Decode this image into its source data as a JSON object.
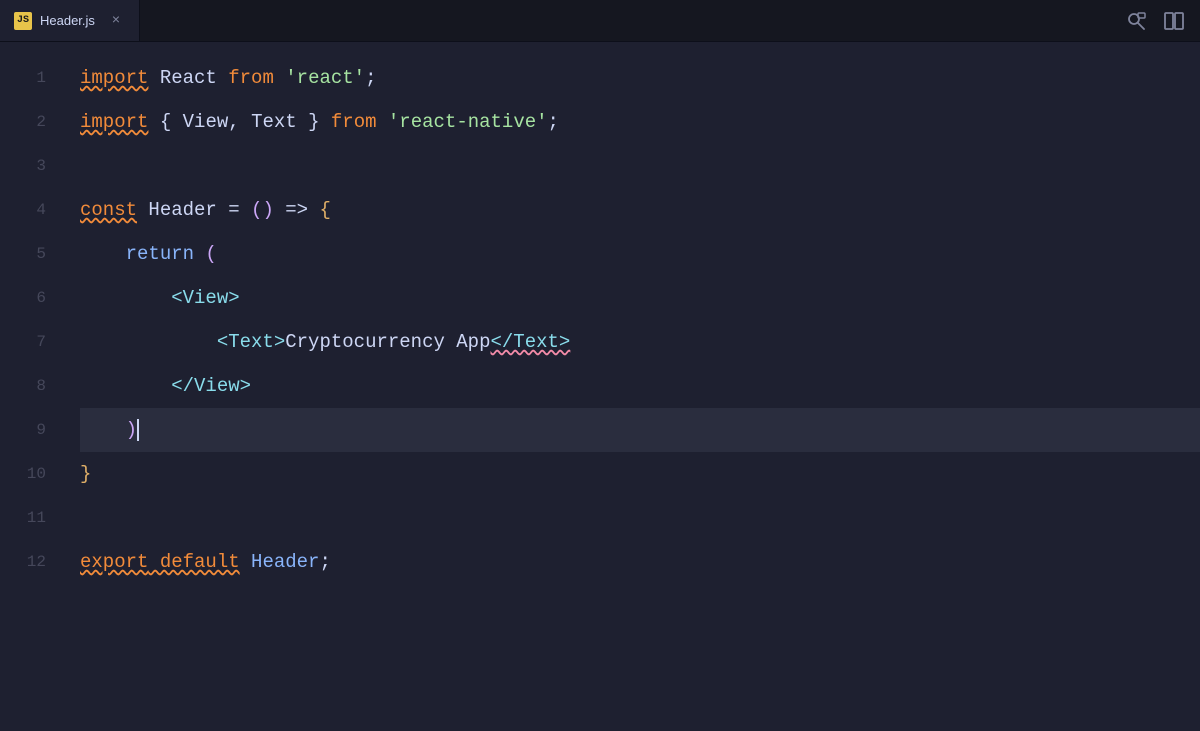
{
  "tab": {
    "icon_label": "JS",
    "filename": "Header.js",
    "close_label": "×"
  },
  "toolbar": {
    "search_icon": "🔍",
    "split_icon": "⊞"
  },
  "lines": [
    {
      "number": 1,
      "tokens": [
        {
          "t": "kw-import",
          "v": "import"
        },
        {
          "t": "identifier",
          "v": " React "
        },
        {
          "t": "kw-from",
          "v": "from"
        },
        {
          "t": "str",
          "v": " 'react'"
        },
        {
          "t": "punct",
          "v": ";"
        }
      ]
    },
    {
      "number": 2,
      "tokens": [
        {
          "t": "kw-import",
          "v": "import"
        },
        {
          "t": "punct",
          "v": " { "
        },
        {
          "t": "identifier",
          "v": "View"
        },
        {
          "t": "punct",
          "v": ", "
        },
        {
          "t": "identifier",
          "v": "Text"
        },
        {
          "t": "punct",
          "v": " } "
        },
        {
          "t": "kw-from",
          "v": "from"
        },
        {
          "t": "str",
          "v": " 'react-native'"
        },
        {
          "t": "punct",
          "v": ";"
        }
      ]
    },
    {
      "number": 3,
      "tokens": []
    },
    {
      "number": 4,
      "tokens": [
        {
          "t": "kw-const",
          "v": "const"
        },
        {
          "t": "identifier",
          "v": " Header "
        },
        {
          "t": "punct",
          "v": "= "
        },
        {
          "t": "paren",
          "v": "()"
        },
        {
          "t": "arrow",
          "v": " => "
        },
        {
          "t": "bracket",
          "v": "{"
        }
      ]
    },
    {
      "number": 5,
      "tokens": [
        {
          "t": "kw-return",
          "v": "return"
        },
        {
          "t": "paren",
          "v": " ("
        }
      ]
    },
    {
      "number": 6,
      "tokens": [
        {
          "t": "tag",
          "v": "<View>"
        }
      ]
    },
    {
      "number": 7,
      "tokens": [
        {
          "t": "tag",
          "v": "<Text>"
        },
        {
          "t": "text-content",
          "v": "Cryptocurrency App"
        },
        {
          "t": "tag",
          "v": "</Text>"
        }
      ]
    },
    {
      "number": 8,
      "tokens": [
        {
          "t": "tag",
          "v": "</View>"
        }
      ]
    },
    {
      "number": 9,
      "tokens": [
        {
          "t": "paren",
          "v": ")"
        }
      ]
    },
    {
      "number": 10,
      "tokens": [
        {
          "t": "bracket",
          "v": "}"
        }
      ]
    },
    {
      "number": 11,
      "tokens": []
    },
    {
      "number": 12,
      "tokens": [
        {
          "t": "kw-export",
          "v": "export"
        },
        {
          "t": "kw-default",
          "v": " default"
        },
        {
          "t": "component",
          "v": " Header"
        },
        {
          "t": "punct",
          "v": ";"
        }
      ]
    }
  ],
  "minimap": {
    "lines": [
      {
        "color": "#f28b3a",
        "width": "80%"
      },
      {
        "color": "#f28b3a",
        "width": "95%"
      },
      {
        "color": "transparent",
        "width": "0"
      },
      {
        "color": "#f28b3a",
        "width": "70%"
      },
      {
        "color": "#89b4fa",
        "width": "40%"
      },
      {
        "color": "#89dceb",
        "width": "30%"
      },
      {
        "color": "#89dceb",
        "width": "60%"
      },
      {
        "color": "#89dceb",
        "width": "35%"
      },
      {
        "color": "#cba6f7",
        "width": "20%"
      },
      {
        "color": "#e0af68",
        "width": "15%"
      },
      {
        "color": "transparent",
        "width": "0"
      },
      {
        "color": "#f28b3a",
        "width": "50%"
      }
    ]
  }
}
